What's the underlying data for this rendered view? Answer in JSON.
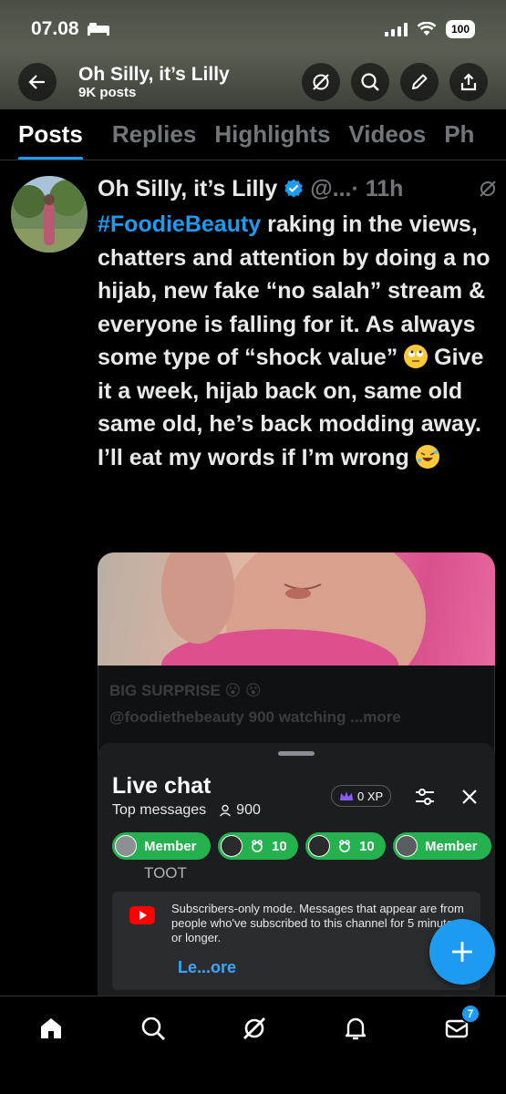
{
  "status_bar": {
    "time": "07.08",
    "battery": "100"
  },
  "header": {
    "name": "Oh Silly, it’s Lilly",
    "posts_count": "9K posts"
  },
  "tabs": [
    "Posts",
    "Replies",
    "Highlights",
    "Videos",
    "Ph"
  ],
  "post": {
    "author": "Oh Silly, it’s Lilly",
    "handle": "@...",
    "time": "· 11h",
    "hashtag": "#FoodieBeauty",
    "text_1": " raking in the views, chatters and attention by doing a no hijab, new fake “no salah” stream & everyone is falling for it. As always some type of “shock value” ",
    "text_2": " Give it a week, hijab back on, same old same old, he’s back modding away. I’ll eat my words if I’m wrong "
  },
  "media_card": {
    "title": "BIG SURPRISE 😮 😮",
    "channel": "@foodiethebeauty",
    "watching": "900 watching",
    "more": "...more"
  },
  "live_chat": {
    "title": "Live chat",
    "mode": "Top messages",
    "viewer_count": "900",
    "xp": "0 XP",
    "chips": [
      {
        "label": "Member"
      },
      {
        "label": "10"
      },
      {
        "label": "10"
      },
      {
        "label": "Member"
      }
    ],
    "partial_message": "TOOT",
    "notice": "Subscribers-only mode. Messages that appear are from people who've subscribed to this channel for 5 minutes or longer.",
    "learn_more": "Le...ore"
  },
  "bottom_nav": {
    "messages_badge": "7"
  },
  "colors": {
    "accent": "#1d9bf0",
    "chip_green": "#25b14f",
    "youtube_red": "#ff0000"
  }
}
